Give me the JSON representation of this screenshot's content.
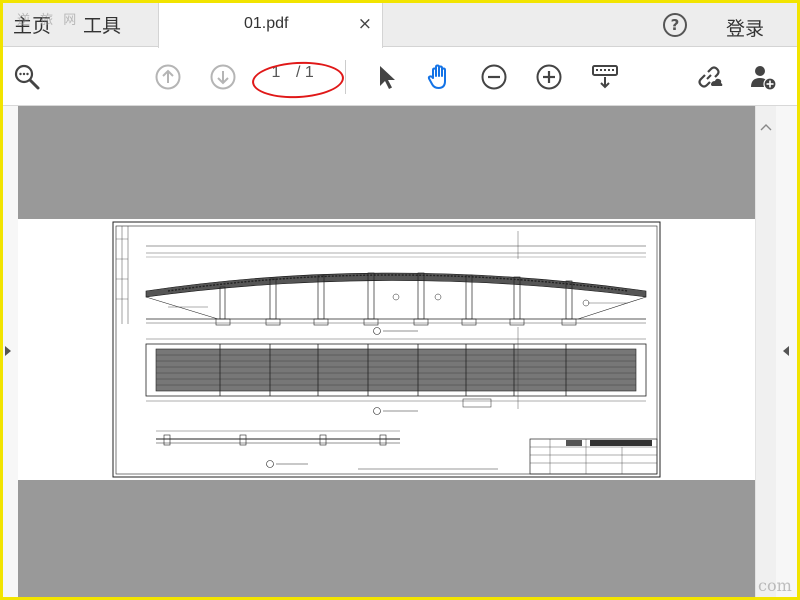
{
  "tabs": {
    "home_label": "主页",
    "tools_label": "工具",
    "document_title": "01.pdf",
    "close_symbol": "×"
  },
  "header": {
    "help_symbol": "?",
    "sign_in_label": "登录"
  },
  "watermark": {
    "top_left": "逆 旅 网",
    "bottom_right": "com"
  },
  "toolbar": {
    "current_page": "1",
    "total_pages": "/ 1",
    "icons": [
      "search-zoom-icon",
      "arrow-up-icon",
      "arrow-down-icon",
      "select-cursor-icon",
      "hand-icon",
      "zoom-out-icon",
      "zoom-in-icon",
      "keyboard-download-icon",
      "share-link-icon",
      "add-user-icon"
    ]
  },
  "colors": {
    "frame_border": "#f2e400",
    "highlight_ellipse": "#e01818",
    "accent_blue": "#1473e6",
    "gray_background": "#999999"
  }
}
